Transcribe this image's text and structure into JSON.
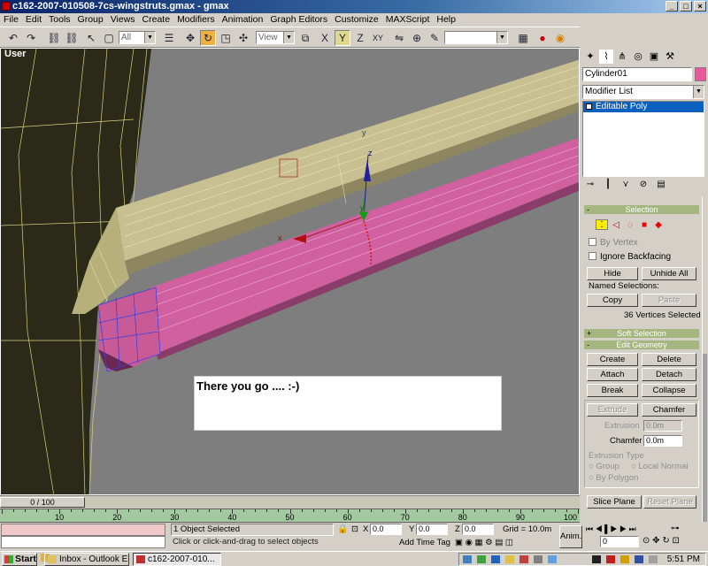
{
  "window": {
    "title": "c162-2007-010508-7cs-wingstruts.gmax - gmax",
    "min": "_",
    "max": "□",
    "close": "×"
  },
  "menu": [
    "File",
    "Edit",
    "Tools",
    "Group",
    "Views",
    "Create",
    "Modifiers",
    "Animation",
    "Graph Editors",
    "Customize",
    "MAXScript",
    "Help"
  ],
  "toolbar": {
    "selection_filter": "All",
    "reference_coord": "View",
    "named_selection": ""
  },
  "viewport": {
    "label": "User",
    "overlay_text": "There you go .... :-)",
    "gizmo_z": "z",
    "gizmo_x": "x",
    "gizmo_y": "y",
    "gizmo_y2": "y"
  },
  "command_panel": {
    "object_name": "Cylinder01",
    "object_color": "#e65a9a",
    "modifier_list": "Modifier List",
    "stack_item": "Editable Poly",
    "selection": {
      "title": "Selection",
      "by_vertex": "By Vertex",
      "ignore_backfacing": "Ignore Backfacing",
      "hide": "Hide",
      "unhide_all": "Unhide All",
      "named_selections": "Named Selections:",
      "copy": "Copy",
      "paste": "Paste",
      "status": "36 Vertices Selected"
    },
    "soft_selection": {
      "title": "Soft Selection"
    },
    "edit_geometry": {
      "title": "Edit Geometry",
      "create": "Create",
      "delete": "Delete",
      "attach": "Attach",
      "detach": "Detach",
      "break": "Break",
      "collapse": "Collapse",
      "extrude": "Extrude",
      "chamfer": "Chamfer",
      "extrusion_label": "Extrusion",
      "extrusion_value": "0.0m",
      "chamfer_label": "Chamfer",
      "chamfer_value": "0.0m",
      "extrusion_type": "Extrusion Type",
      "group": "Group",
      "local_normal": "Local Normal",
      "by_polygon": "By Polygon",
      "slice_plane": "Slice Plane",
      "reset_plane": "Reset Plane"
    }
  },
  "timeline": {
    "frame_display": "0 / 100",
    "current": 0,
    "total": 100,
    "ticks": [
      "0",
      "10",
      "20",
      "30",
      "40",
      "50",
      "60",
      "70",
      "80",
      "90",
      "100"
    ]
  },
  "status": {
    "selected": "1 Object Selected",
    "prompt": "Click or click-and-drag to select objects",
    "x_label": "X",
    "x_value": "0.0",
    "y_label": "Y",
    "y_value": "0.0",
    "z_label": "Z",
    "z_value": "0.0",
    "grid": "Grid = 10.0m",
    "add_time_tag": "Add Time Tag",
    "anim": "Anim.",
    "frame_field": "0"
  },
  "taskbar": {
    "start": "Start",
    "tasks": [
      "Inbox - Outlook E...",
      "c162-2007-010..."
    ],
    "clock": "5:51 PM"
  }
}
